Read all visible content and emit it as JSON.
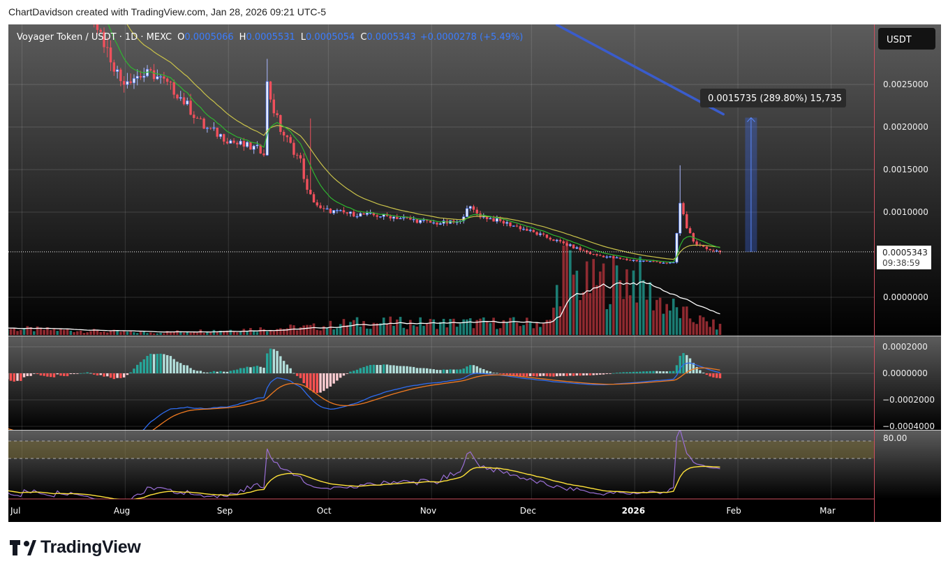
{
  "header": "ChartDavidson created with TradingView.com, Jan 28, 2026 09:21 UTC-5",
  "legend": {
    "symbol": "Voyager Token / USDT · 1D · MEXC",
    "o_label": "O",
    "o": "0.0005066",
    "h_label": "H",
    "h": "0.0005531",
    "l_label": "L",
    "l": "0.0005054",
    "c_label": "C",
    "c": "0.0005343",
    "change": "+0.0000278 (+5.49%)"
  },
  "currency_button": "USDT",
  "last_price": "0.0005343",
  "countdown": "09:38:59",
  "measure_label": "0.0015735 (289.80%) 15,735",
  "brand": "TradingView",
  "colors": {
    "up": "#e6ecff",
    "up_border": "#3f6fff",
    "down": "#f0505c",
    "ema_fast": "#2fb52f",
    "ema_slow": "#c9c24a",
    "macd": "#2f6cf0",
    "signal": "#f07a20",
    "rsi": "#9a6fd6",
    "rsi_ma": "#ffe23a",
    "trendline": "#3a5ccc"
  },
  "chart_data": {
    "type": "candlestick",
    "title": "Voyager Token / USDT · 1D · MEXC",
    "price_axis": {
      "ticks": [
        "0.0025000",
        "0.0020000",
        "0.0015000",
        "0.0010000",
        "0.0000000"
      ],
      "values": [
        0.0025,
        0.002,
        0.0015,
        0.001,
        0
      ]
    },
    "macd_axis": {
      "ticks": [
        "0.0002000",
        "0.0000000",
        "−0.0002000",
        "−0.0004000"
      ],
      "values": [
        0.0002,
        0,
        -0.0002,
        -0.0004
      ]
    },
    "rsi_axis": {
      "ticks": [
        "80.00"
      ],
      "values": [
        80
      ]
    },
    "time_axis": {
      "labels": [
        "Jul",
        "Aug",
        "Sep",
        "Oct",
        "Nov",
        "Dec",
        "2026",
        "Feb",
        "Mar"
      ],
      "days_since_jul1": [
        0,
        31,
        62,
        92,
        123,
        153,
        184,
        215,
        243
      ]
    },
    "close_keypoints_day_price": [
      [
        22,
        0.0034
      ],
      [
        27,
        0.0029
      ],
      [
        31,
        0.00255
      ],
      [
        36,
        0.0026
      ],
      [
        41,
        0.00262
      ],
      [
        48,
        0.0024
      ],
      [
        56,
        0.002
      ],
      [
        66,
        0.0018
      ],
      [
        74,
        0.00172
      ],
      [
        75,
        0.0025
      ],
      [
        77,
        0.0022
      ],
      [
        79,
        0.00197
      ],
      [
        85,
        0.0016
      ],
      [
        87,
        0.00124
      ],
      [
        91,
        0.00103
      ],
      [
        100,
        0.00098
      ],
      [
        112,
        0.00095
      ],
      [
        125,
        0.00087
      ],
      [
        133,
        0.00088
      ],
      [
        135,
        0.00107
      ],
      [
        139,
        0.00096
      ],
      [
        150,
        0.00083
      ],
      [
        162,
        0.00066
      ],
      [
        173,
        0.0005
      ],
      [
        183,
        0.00044
      ],
      [
        197,
        0.0004
      ],
      [
        199,
        0.0011
      ],
      [
        201,
        0.00082
      ],
      [
        204,
        0.0006
      ],
      [
        211,
        0.000534
      ]
    ],
    "volume_relative_keypoints": [
      [
        -3,
        0.08
      ],
      [
        40,
        0.03
      ],
      [
        90,
        0.1
      ],
      [
        100,
        0.15
      ],
      [
        130,
        0.15
      ],
      [
        160,
        0.15
      ],
      [
        164,
        0.9
      ],
      [
        170,
        0.6
      ],
      [
        185,
        0.75
      ],
      [
        190,
        0.5
      ],
      [
        200,
        0.25
      ],
      [
        211,
        0.1
      ]
    ],
    "trendline_price": [
      [
        162,
        0.0032
      ],
      [
        212,
        0.00215
      ]
    ],
    "measure": {
      "from_price": 0.000534,
      "to_price": 0.00211,
      "day": 220
    }
  }
}
